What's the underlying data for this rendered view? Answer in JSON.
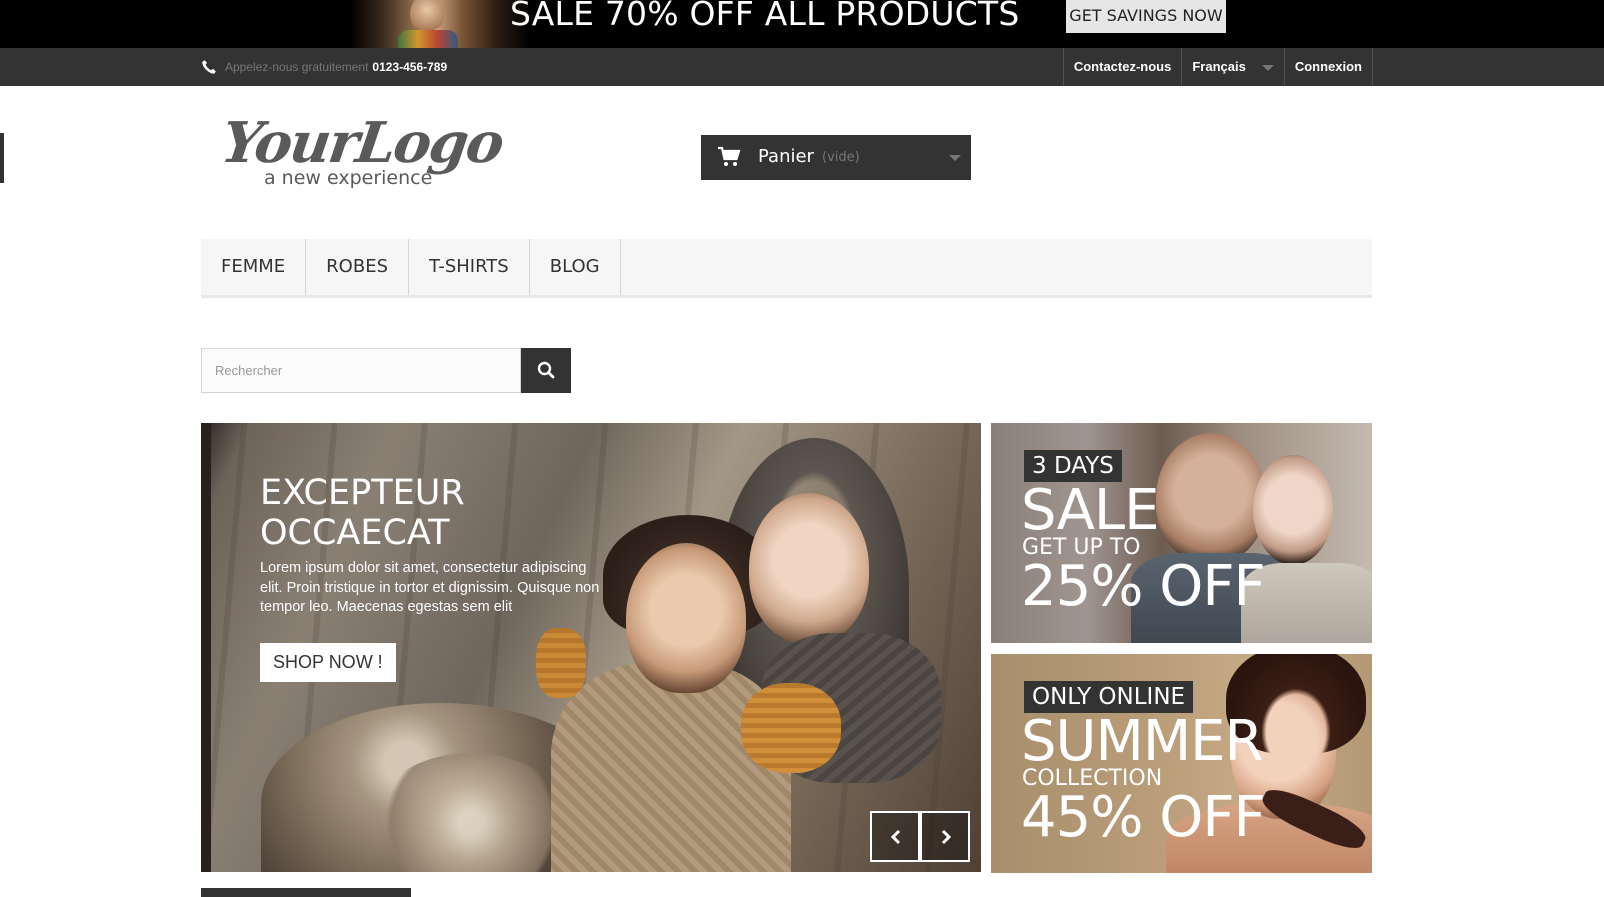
{
  "promo": {
    "title": "SALE 70% OFF ALL PRODUCTS",
    "cta": "GET SAVINGS NOW"
  },
  "topbar": {
    "phone_icon": "phone-icon",
    "phone_label": "Appelez-nous gratuitement",
    "phone_number": "0123-456-789",
    "links": {
      "contact": "Contactez-nous",
      "language": "Français",
      "login": "Connexion"
    }
  },
  "logo": {
    "main": "YourLogo",
    "tagline": "a new experience"
  },
  "cart": {
    "icon": "shopping-cart-icon",
    "label": "Panier",
    "status": "(vide)"
  },
  "nav": {
    "items": [
      "FEMME",
      "ROBES",
      "T-SHIRTS",
      "BLOG"
    ]
  },
  "search": {
    "placeholder": "Rechercher",
    "value": "",
    "icon": "search-icon"
  },
  "slider": {
    "title": "EXCEPTEUR OCCAECAT",
    "text": "Lorem ipsum dolor sit amet, consectetur adipiscing elit. Proin tristique in tortor et dignissim. Quisque non tempor leo. Maecenas egestas sem elit",
    "button": "SHOP NOW !",
    "prev_icon": "chevron-left-icon",
    "next_icon": "chevron-right-icon"
  },
  "banners": [
    {
      "tag": "3 DAYS",
      "big": "SALE",
      "mid": "GET UP TO",
      "pct": "25% OFF"
    },
    {
      "tag": "ONLY ONLINE",
      "big": "SUMMER",
      "mid": "COLLECTION",
      "pct": "45% OFF"
    }
  ],
  "colors": {
    "dark": "#333333",
    "nav_bg": "#f6f6f6",
    "promo_bg": "#000000",
    "cta_bg": "#e6e6e6"
  }
}
